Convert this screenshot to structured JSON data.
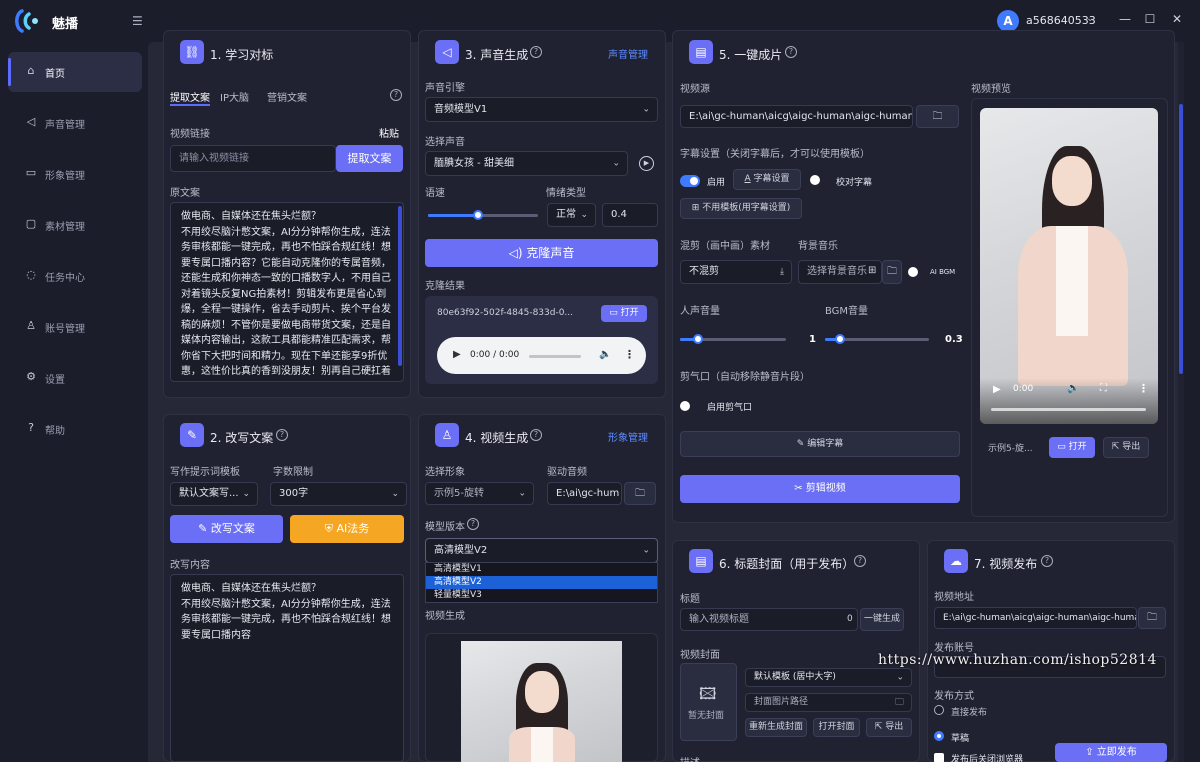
{
  "app": {
    "name": "魅播",
    "username": "a568640533",
    "avatar_letter": "A"
  },
  "nav": [
    {
      "label": "首页",
      "icon": "home-icon"
    },
    {
      "label": "声音管理",
      "icon": "speaker-icon"
    },
    {
      "label": "形象管理",
      "icon": "video-icon"
    },
    {
      "label": "素材管理",
      "icon": "folder-icon"
    },
    {
      "label": "任务中心",
      "icon": "task-icon"
    },
    {
      "label": "账号管理",
      "icon": "user-icon"
    },
    {
      "label": "设置",
      "icon": "gear-icon"
    },
    {
      "label": "帮助",
      "icon": "help-icon"
    }
  ],
  "p1": {
    "title": "1. 学习对标",
    "tabs": [
      "提取文案",
      "IP大脑",
      "营销文案"
    ],
    "video_link_label": "视频链接",
    "paste": "粘贴",
    "link_placeholder": "请输入视频链接",
    "extract_btn": "提取文案",
    "original_label": "原文案",
    "original_text": "做电商、自媒体还在焦头烂额？\n不用绞尽脑汁憋文案，AI分分钟帮你生成，连法务审核都能一键完成，再也不怕踩合规红线！想要专属口播内容？它能自动克隆你的专属音频，还能生成和你神态一致的口播数字人，不用自己对着镜头反复NG拍素材！剪辑发布更是省心到爆，全程一键操作，省去手动剪片、挨个平台发稿的麻烦！不管你是要做电商带货文案，还是自媒体内容输出，这款工具都能精准匹配需求，帮你省下大把时间和精力。现在下单还能享9折优惠，这性价比真的香到没朋友！别再自己硬扛着"
  },
  "p2": {
    "title": "2. 改写文案",
    "prompt_label": "写作提示词模板",
    "prompt_value": "默认文案写...",
    "limit_label": "字数限制",
    "limit_value": "300字",
    "rewrite_btn": "改写文案",
    "legal_btn": "AI法务",
    "content_label": "改写内容",
    "content_text": "做电商、自媒体还在焦头烂额？\n不用绞尽脑汁憋文案，AI分分钟帮你生成，连法务审核都能一键完成，再也不怕踩合规红线！想要专属口播内容"
  },
  "p3": {
    "title": "3. 声音生成",
    "manage_link": "声音管理",
    "engine_label": "声音引擎",
    "engine_value": "音频模型V1",
    "voice_label": "选择声音",
    "voice_value": "腼腆女孩 - 甜美细",
    "speed_label": "语速",
    "speed_fraction": 0.45,
    "emotion_label": "情绪类型",
    "emotion_value": "正常",
    "emotion_num": "0.4",
    "clone_btn": "克隆声音",
    "result_label": "克隆结果",
    "result_id": "80e63f92-502f-4845-833d-0...",
    "open": "打开",
    "audio_time": "0:00 / 0:00"
  },
  "p4": {
    "title": "4. 视频生成",
    "manage_link": "形象管理",
    "avatar_label": "选择形象",
    "avatar_value": "示例5-旋转",
    "audio_label": "驱动音频",
    "audio_value": "E:\\ai\\gc-hum",
    "model_label": "模型版本",
    "model_value": "高清模型V2",
    "model_options": [
      "高清模型V1",
      "高清模型V2",
      "轻量模型V3"
    ],
    "model_selected_index": 1,
    "gen_label": "视频生成"
  },
  "p5": {
    "title": "5. 一键成片",
    "source_label": "视频源",
    "source_value": "E:\\ai\\gc-human\\aicg\\aigc-human\\aigc-human\\out",
    "subtitle_label": "字幕设置（关闭字幕后，才可以使用模板）",
    "enable": "启用",
    "subtitle_settings": "字幕设置",
    "proofread": "校对字幕",
    "no_template": "不用模板(用字幕设置)",
    "mix_label": "混剪（画中画）素材",
    "mix_value": "不混剪",
    "bgm_label": "背景音乐",
    "bgm_placeholder": "选择背景音乐",
    "ai_bgm": "AI BGM",
    "voice_vol_label": "人声音量",
    "voice_vol": "1",
    "voice_vol_fraction": 0.17,
    "bgm_vol_label": "BGM音量",
    "bgm_vol": "0.3",
    "bgm_vol_fraction": 0.14,
    "breath_label": "剪气口（自动移除静音片段）",
    "breath_enable": "启用剪气口",
    "edit_subtitle": "编辑字幕",
    "cut_video": "剪辑视频",
    "preview_label": "视频预览",
    "preview_time": "0:00",
    "preview_name": "示例5-旋...",
    "open": "打开",
    "export": "导出"
  },
  "p6": {
    "title": "6. 标题封面（用于发布）",
    "title_label": "标题",
    "title_placeholder": "输入视频标题",
    "title_count": "0",
    "gen_btn": "一键生成",
    "cover_label": "视频封面",
    "no_cover": "暂无封面",
    "template_value": "默认模板 (居中大字)",
    "cover_path_placeholder": "封面图片路径",
    "regen": "重新生成封面",
    "open_cover": "打开封面",
    "export": "导出",
    "desc_label": "描述"
  },
  "p7": {
    "title": "7. 视频发布",
    "addr_label": "视频地址",
    "addr_value": "E:\\ai\\gc-human\\aicg\\aigc-human\\aigc-human\\c",
    "account_label": "发布账号",
    "method_label": "发布方式",
    "direct": "直接发布",
    "draft": "草稿",
    "close_browser": "发布后关闭浏览器",
    "publish": "立即发布"
  },
  "watermark": "https://www.huzhan.com/ishop52814"
}
